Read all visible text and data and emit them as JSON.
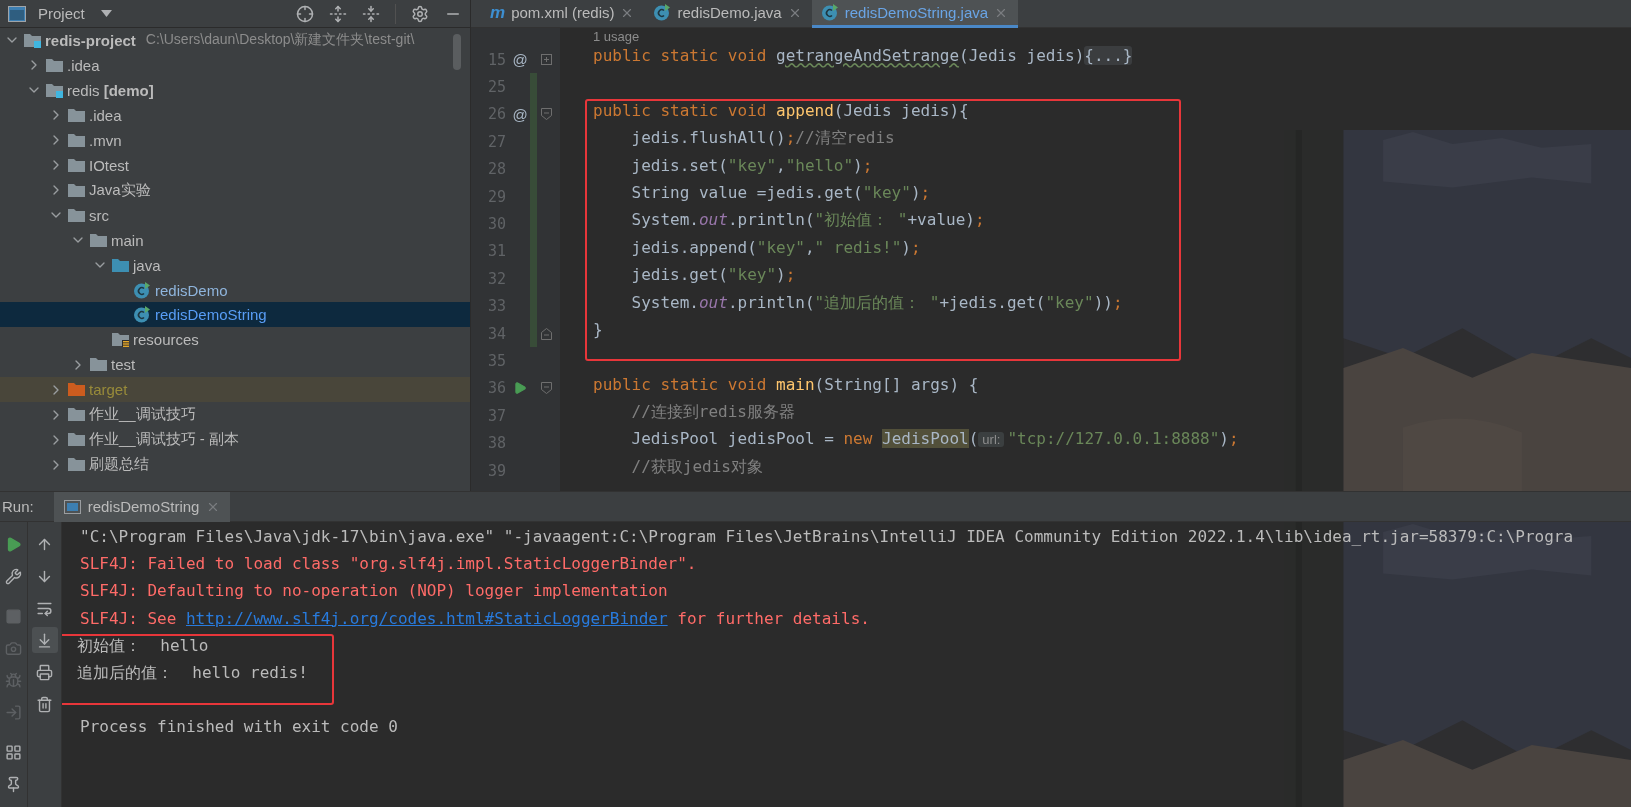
{
  "project_panel": {
    "title": "Project",
    "tree": [
      {
        "label": "redis-project",
        "path": "C:\\Users\\daun\\Desktop\\新建文件夹\\test-git\\",
        "kind": "module",
        "expanded": true,
        "selected": false,
        "children": [
          {
            "label": ".idea",
            "kind": "folder",
            "expanded": false,
            "selected": false
          },
          {
            "label": "redis **[demo]**",
            "kind": "module",
            "expanded": true,
            "selected": false,
            "children": [
              {
                "label": ".idea",
                "kind": "folder",
                "expanded": false,
                "selected": false
              },
              {
                "label": ".mvn",
                "kind": "folder",
                "expanded": false,
                "selected": false
              },
              {
                "label": "IOtest",
                "kind": "folder",
                "expanded": false,
                "selected": false
              },
              {
                "label": "Java实验",
                "kind": "folder",
                "expanded": false,
                "selected": false
              },
              {
                "label": "src",
                "kind": "folder",
                "expanded": true,
                "selected": false,
                "children": [
                  {
                    "label": "main",
                    "kind": "folder",
                    "expanded": true,
                    "selected": false,
                    "children": [
                      {
                        "label": "java",
                        "kind": "source-folder",
                        "expanded": true,
                        "selected": false,
                        "children": [
                          {
                            "label": "redisDemo",
                            "kind": "class",
                            "selected": false
                          },
                          {
                            "label": "redisDemoString",
                            "kind": "class",
                            "selected": true
                          }
                        ]
                      },
                      {
                        "label": "resources",
                        "kind": "resource-folder",
                        "selected": false
                      }
                    ]
                  },
                  {
                    "label": "test",
                    "kind": "folder",
                    "expanded": false,
                    "selected": false
                  }
                ]
              },
              {
                "label": "target",
                "kind": "excluded-folder",
                "expanded": false,
                "selected": false
              },
              {
                "label": "作业__调试技巧",
                "kind": "folder",
                "expanded": false,
                "selected": false
              },
              {
                "label": "作业__调试技巧 - 副本",
                "kind": "folder",
                "expanded": false,
                "selected": false
              },
              {
                "label": "刷题总结",
                "kind": "folder",
                "expanded": false,
                "selected": false
              }
            ]
          }
        ]
      }
    ]
  },
  "editor": {
    "tabs": [
      {
        "label": "pom.xml (redis)",
        "kind": "maven",
        "glyph": "m",
        "selected": false
      },
      {
        "label": "redisDemo.java",
        "kind": "class",
        "selected": false
      },
      {
        "label": "redisDemoString.java",
        "kind": "class",
        "selected": true
      }
    ],
    "usage_hint": "1 usage",
    "lines": [
      {
        "number": "15",
        "gutter": {
          "kind": "override",
          "glyph": "@"
        },
        "fold": {
          "kind": "collapsed"
        },
        "changed": false,
        "boxed": false,
        "tokens": [
          {
            "kind": "kw",
            "text": "public static void "
          },
          {
            "kind": "typo",
            "text": "getrangeAndSetrange"
          },
          {
            "kind": "plain",
            "text": "(Jedis jedis)"
          },
          {
            "kind": "chip",
            "text": "{...}"
          }
        ]
      },
      {
        "number": "25",
        "changed": true,
        "boxed": false
      },
      {
        "number": "26",
        "gutter": {
          "kind": "override",
          "glyph": "@"
        },
        "fold": {
          "kind": "open"
        },
        "changed": true,
        "boxed": true,
        "tokens": [
          {
            "kind": "kw",
            "text": "public static void "
          },
          {
            "kind": "fn",
            "text": "append"
          },
          {
            "kind": "plain",
            "text": "(Jedis jedis){"
          }
        ]
      },
      {
        "number": "27",
        "changed": true,
        "boxed": true,
        "tokens": [
          {
            "kind": "plain",
            "text": "    jedis.flushAll()"
          },
          {
            "kind": "punct",
            "text": ";"
          },
          {
            "kind": "cmt",
            "text": "//清空redis"
          }
        ]
      },
      {
        "number": "28",
        "changed": true,
        "boxed": true,
        "tokens": [
          {
            "kind": "plain",
            "text": "    jedis.set("
          },
          {
            "kind": "str",
            "text": "\"key\""
          },
          {
            "kind": "plain",
            "text": ","
          },
          {
            "kind": "str",
            "text": "\"hello\""
          },
          {
            "kind": "plain",
            "text": ")"
          },
          {
            "kind": "punct",
            "text": ";"
          }
        ]
      },
      {
        "number": "29",
        "changed": true,
        "boxed": true,
        "tokens": [
          {
            "kind": "plain",
            "text": "    String value =jedis.get("
          },
          {
            "kind": "str",
            "text": "\"key\""
          },
          {
            "kind": "plain",
            "text": ")"
          },
          {
            "kind": "punct",
            "text": ";"
          }
        ]
      },
      {
        "number": "30",
        "changed": true,
        "boxed": true,
        "tokens": [
          {
            "kind": "plain",
            "text": "    System."
          },
          {
            "kind": "field",
            "text": "out"
          },
          {
            "kind": "plain",
            "text": ".println("
          },
          {
            "kind": "str",
            "text": "\"初始值： \""
          },
          {
            "kind": "plain",
            "text": "+value)"
          },
          {
            "kind": "punct",
            "text": ";"
          }
        ]
      },
      {
        "number": "31",
        "changed": true,
        "boxed": true,
        "tokens": [
          {
            "kind": "plain",
            "text": "    jedis.append("
          },
          {
            "kind": "str",
            "text": "\"key\""
          },
          {
            "kind": "plain",
            "text": ","
          },
          {
            "kind": "str",
            "text": "\" redis!\""
          },
          {
            "kind": "plain",
            "text": ")"
          },
          {
            "kind": "punct",
            "text": ";"
          }
        ]
      },
      {
        "number": "32",
        "changed": true,
        "boxed": true,
        "tokens": [
          {
            "kind": "plain",
            "text": "    jedis.get("
          },
          {
            "kind": "str",
            "text": "\"key\""
          },
          {
            "kind": "plain",
            "text": ")"
          },
          {
            "kind": "punct",
            "text": ";"
          }
        ]
      },
      {
        "number": "33",
        "changed": true,
        "boxed": true,
        "tokens": [
          {
            "kind": "plain",
            "text": "    System."
          },
          {
            "kind": "field",
            "text": "out"
          },
          {
            "kind": "plain",
            "text": ".println("
          },
          {
            "kind": "str",
            "text": "\"追加后的值： \""
          },
          {
            "kind": "plain",
            "text": "+jedis.get("
          },
          {
            "kind": "str",
            "text": "\"key\""
          },
          {
            "kind": "plain",
            "text": "))"
          },
          {
            "kind": "punct",
            "text": ";"
          }
        ]
      },
      {
        "number": "34",
        "fold": {
          "kind": "close"
        },
        "changed": true,
        "boxed": true,
        "tokens": [
          {
            "kind": "plain",
            "text": "}"
          }
        ]
      },
      {
        "number": "35",
        "changed": false,
        "boxed": false
      },
      {
        "number": "36",
        "gutter": {
          "kind": "run"
        },
        "fold": {
          "kind": "open"
        },
        "changed": false,
        "boxed": false,
        "tokens": [
          {
            "kind": "kw",
            "text": "public static void "
          },
          {
            "kind": "fn",
            "text": "main"
          },
          {
            "kind": "plain",
            "text": "(String[] args) {"
          }
        ]
      },
      {
        "number": "37",
        "changed": false,
        "boxed": false,
        "tokens": [
          {
            "kind": "cmt",
            "text": "    //连接到redis服务器"
          }
        ]
      },
      {
        "number": "38",
        "changed": false,
        "boxed": false,
        "tokens": [
          {
            "kind": "plain",
            "text": "    JedisPool jedisPool = "
          },
          {
            "kind": "kw",
            "text": "new"
          },
          {
            "kind": "match",
            "text": " JedisPool"
          },
          {
            "kind": "plain",
            "text": "("
          },
          {
            "kind": "hint",
            "text": "url:"
          },
          {
            "kind": "str",
            "text": "\"tcp://127.0.0.1:8888\""
          },
          {
            "kind": "plain",
            "text": ")"
          },
          {
            "kind": "punct",
            "text": ";"
          }
        ]
      },
      {
        "number": "39",
        "changed": false,
        "boxed": false,
        "tokens": [
          {
            "kind": "cmt",
            "text": "    //获取jedis对象"
          }
        ]
      }
    ]
  },
  "run_panel": {
    "label": "Run:",
    "tab": {
      "label": "redisDemoString",
      "selected": true
    },
    "left_tools": [
      {
        "kind": "rerun",
        "disabled": false
      },
      {
        "kind": "settings",
        "disabled": false
      },
      {
        "kind": "stop",
        "disabled": true
      },
      {
        "kind": "snapshot",
        "disabled": true
      },
      {
        "kind": "debug",
        "disabled": true
      },
      {
        "kind": "exit",
        "disabled": true
      },
      {
        "kind": "layout",
        "disabled": false
      },
      {
        "kind": "pin",
        "disabled": false
      }
    ],
    "console_tools": [
      {
        "kind": "up",
        "selected": false
      },
      {
        "kind": "down",
        "selected": false
      },
      {
        "kind": "wrap",
        "selected": false
      },
      {
        "kind": "scroll-end",
        "selected": true
      },
      {
        "kind": "print",
        "selected": false
      },
      {
        "kind": "clear",
        "selected": false
      }
    ],
    "output": [
      {
        "kind": "command",
        "boxed": false,
        "parts": [
          {
            "kind": "text",
            "text": "\"C:\\Program Files\\Java\\jdk-17\\bin\\java.exe\" \"-javaagent:C:\\Program Files\\JetBrains\\IntelliJ IDEA Community Edition 2022.1.4\\lib\\idea_rt.jar=58379:C:\\Progra"
          }
        ]
      },
      {
        "kind": "error",
        "boxed": false,
        "parts": [
          {
            "kind": "text",
            "text": "SLF4J: Failed to load class \"org.slf4j.impl.StaticLoggerBinder\"."
          }
        ]
      },
      {
        "kind": "error",
        "boxed": false,
        "parts": [
          {
            "kind": "text",
            "text": "SLF4J: Defaulting to no-operation (NOP) logger implementation"
          }
        ]
      },
      {
        "kind": "error",
        "boxed": false,
        "parts": [
          {
            "kind": "text",
            "text": "SLF4J: See "
          },
          {
            "kind": "link",
            "text": "http://www.slf4j.org/codes.html#StaticLoggerBinder"
          },
          {
            "kind": "text",
            "text": " for further details."
          }
        ]
      },
      {
        "kind": "output",
        "boxed": true,
        "parts": [
          {
            "kind": "text",
            "text": "初始值：  hello"
          }
        ]
      },
      {
        "kind": "output",
        "boxed": true,
        "parts": [
          {
            "kind": "text",
            "text": "追加后的值：  hello redis!"
          }
        ]
      },
      {
        "kind": "exit",
        "boxed": false,
        "parts": [
          {
            "kind": "text",
            "text": "Process finished with exit code 0"
          }
        ]
      }
    ]
  }
}
